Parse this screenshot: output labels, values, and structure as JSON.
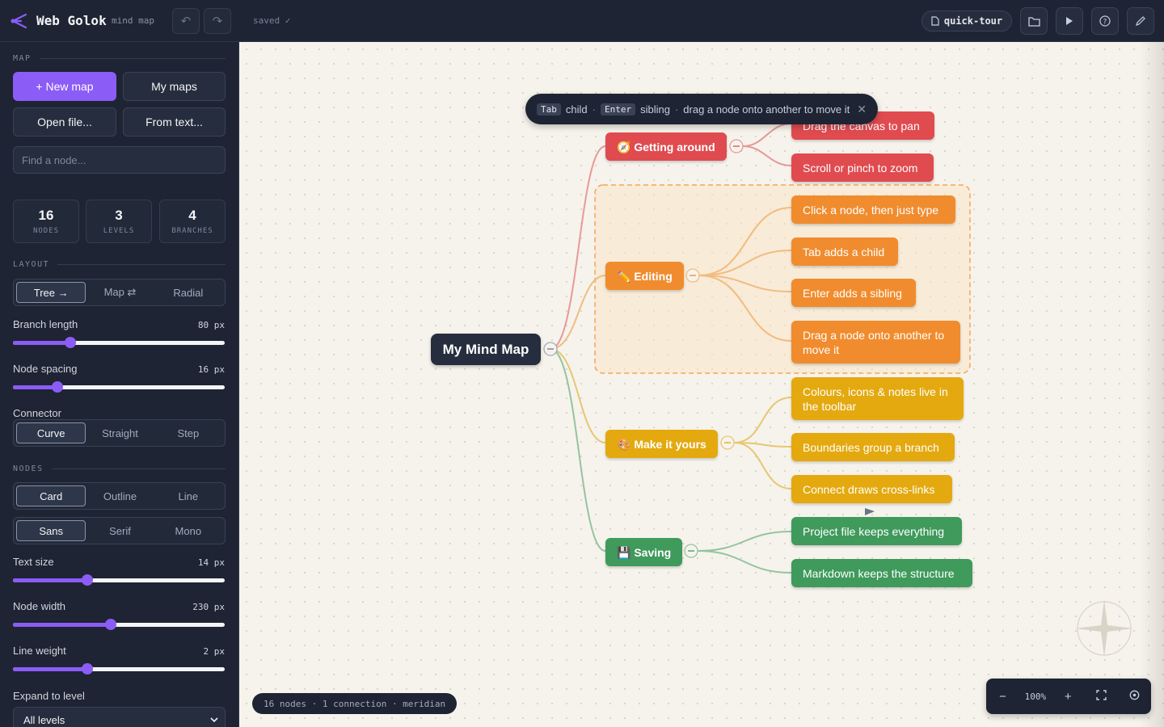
{
  "app": {
    "name": "Web Golok",
    "subtitle": "mind map",
    "save_status": "saved ✓",
    "file_name": "quick-tour"
  },
  "sidebar": {
    "map_title": "MAP",
    "new_map": "+ New map",
    "my_maps": "My maps",
    "open_file": "Open file...",
    "from_text": "From text...",
    "find_placeholder": "Find a node...",
    "stats": [
      {
        "value": "16",
        "label": "NODES"
      },
      {
        "value": "3",
        "label": "LEVELS"
      },
      {
        "value": "4",
        "label": "BRANCHES"
      }
    ],
    "layout_title": "LAYOUT",
    "layout_options": [
      "Tree →",
      "Map ⇄",
      "Radial"
    ],
    "layout_selected": "Tree →",
    "branch_length": {
      "label": "Branch length",
      "value": "80 px",
      "fraction": 0.27
    },
    "node_spacing": {
      "label": "Node spacing",
      "value": "16 px",
      "fraction": 0.21
    },
    "connector_label": "Connector",
    "connector_options": [
      "Curve",
      "Straight",
      "Step"
    ],
    "connector_selected": "Curve",
    "nodes_title": "NODES",
    "node_style_options": [
      "Card",
      "Outline",
      "Line"
    ],
    "node_style_selected": "Card",
    "font_options": [
      "Sans",
      "Serif",
      "Mono"
    ],
    "font_selected": "Sans",
    "text_size": {
      "label": "Text size",
      "value": "14 px",
      "fraction": 0.35
    },
    "node_width": {
      "label": "Node width",
      "value": "230 px",
      "fraction": 0.46
    },
    "line_weight": {
      "label": "Line weight",
      "value": "2 px",
      "fraction": 0.35
    },
    "expand_label": "Expand to level",
    "expand_value": "All levels"
  },
  "canvas": {
    "hint": {
      "key1": "Tab",
      "text1": "child",
      "key2": "Enter",
      "text2": "sibling",
      "text3": "drag a node onto another to move it"
    },
    "root": "My Mind Map",
    "branches": [
      {
        "label": "🧭 Getting around",
        "color": "#e04b4f",
        "children": [
          "Drag the canvas to pan",
          "Scroll or pinch to zoom"
        ]
      },
      {
        "label": "✏️ Editing",
        "color": "#f08c2e",
        "children": [
          "Click a node, then just type",
          "Tab adds a child",
          "Enter adds a sibling",
          "Drag a node onto another to move it"
        ]
      },
      {
        "label": "🎨 Make it yours",
        "color": "#e3a90f",
        "children": [
          "Colours, icons & notes live in the toolbar",
          "Boundaries group a branch",
          "Connect draws cross-links"
        ]
      },
      {
        "label": "💾 Saving",
        "color": "#3f9a5c",
        "children": [
          "Project file keeps everything",
          "Markdown keeps the structure"
        ]
      }
    ],
    "status": "16 nodes · 1 connection · meridian",
    "zoom": "100%"
  }
}
